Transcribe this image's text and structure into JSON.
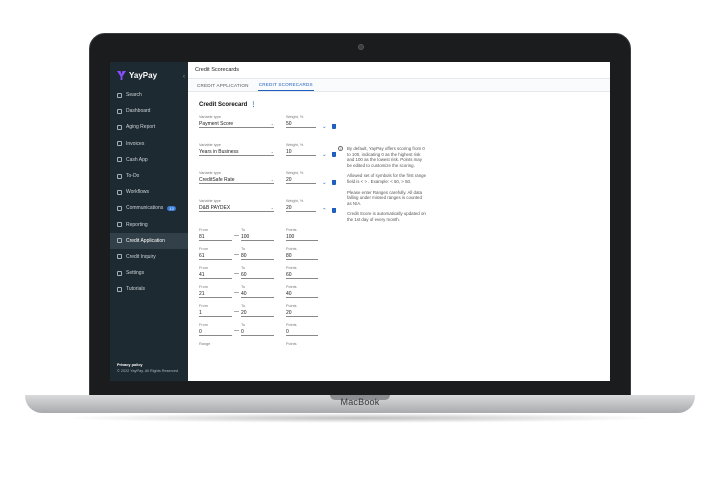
{
  "device": {
    "label": "MacBook"
  },
  "app": {
    "brand": "YayPay",
    "page_title": "Credit Scorecards"
  },
  "sidebar": {
    "items": [
      {
        "label": "Search",
        "icon": "search-icon"
      },
      {
        "label": "Dashboard",
        "icon": "dashboard-icon"
      },
      {
        "label": "Aging Report",
        "icon": "report-icon"
      },
      {
        "label": "Invoices",
        "icon": "invoice-icon"
      },
      {
        "label": "Cash App",
        "icon": "dollar-icon"
      },
      {
        "label": "To-Do",
        "icon": "todo-icon"
      },
      {
        "label": "Workflows",
        "icon": "workflow-icon"
      },
      {
        "label": "Communications",
        "icon": "mail-icon",
        "badge": "13"
      },
      {
        "label": "Reporting",
        "icon": "chart-icon"
      },
      {
        "label": "Credit Application",
        "icon": "card-icon",
        "active": true
      },
      {
        "label": "Credit Inquiry",
        "icon": "inquiry-icon"
      },
      {
        "label": "Settings",
        "icon": "gear-icon"
      },
      {
        "label": "Tutorials",
        "icon": "play-icon"
      }
    ],
    "footer_link": "Privacy policy",
    "footer_copy": "© 2022 YayPay. All Rights Reserved"
  },
  "tabs": [
    {
      "label": "CREDIT APPLICATION",
      "active": false
    },
    {
      "label": "CREDIT SCORECARDS",
      "active": true
    }
  ],
  "scorecard": {
    "title": "Credit Scorecard",
    "variable_label": "Variable type",
    "weight_label": "Weight, %",
    "variables": [
      {
        "type": "Payment Score",
        "weight": "50"
      },
      {
        "type": "Years in Business",
        "weight": "10"
      },
      {
        "type": "CreditSafe Rate",
        "weight": "20"
      },
      {
        "type": "D&B PAYDEX",
        "weight": "20"
      }
    ],
    "range_labels": {
      "from": "From",
      "to": "To",
      "points": "Points",
      "range": "Range"
    },
    "ranges": [
      {
        "from": "81",
        "to": "100",
        "points": "100"
      },
      {
        "from": "61",
        "to": "80",
        "points": "80"
      },
      {
        "from": "41",
        "to": "60",
        "points": "60"
      },
      {
        "from": "21",
        "to": "40",
        "points": "40"
      },
      {
        "from": "1",
        "to": "20",
        "points": "20"
      },
      {
        "from": "0",
        "to": "0",
        "points": "0"
      }
    ]
  },
  "info": [
    "By default, YayPay offers scoring from 0 to 100, indicating 0 as the highest risk and 100 as the lowest risk. Points may be edited to customize the scoring.",
    "Allowed set of symbols for the first range field is < > . Example: < 50, > 50.",
    "Please enter Ranges carefully. All data falling under missed ranges is counted as N/A.",
    "Credit Score is automatically updated on the 1st day of every month."
  ],
  "colors": {
    "sidebar": "#1e2a31",
    "accent": "#1f5fbf",
    "brand": "#8c4dff"
  }
}
